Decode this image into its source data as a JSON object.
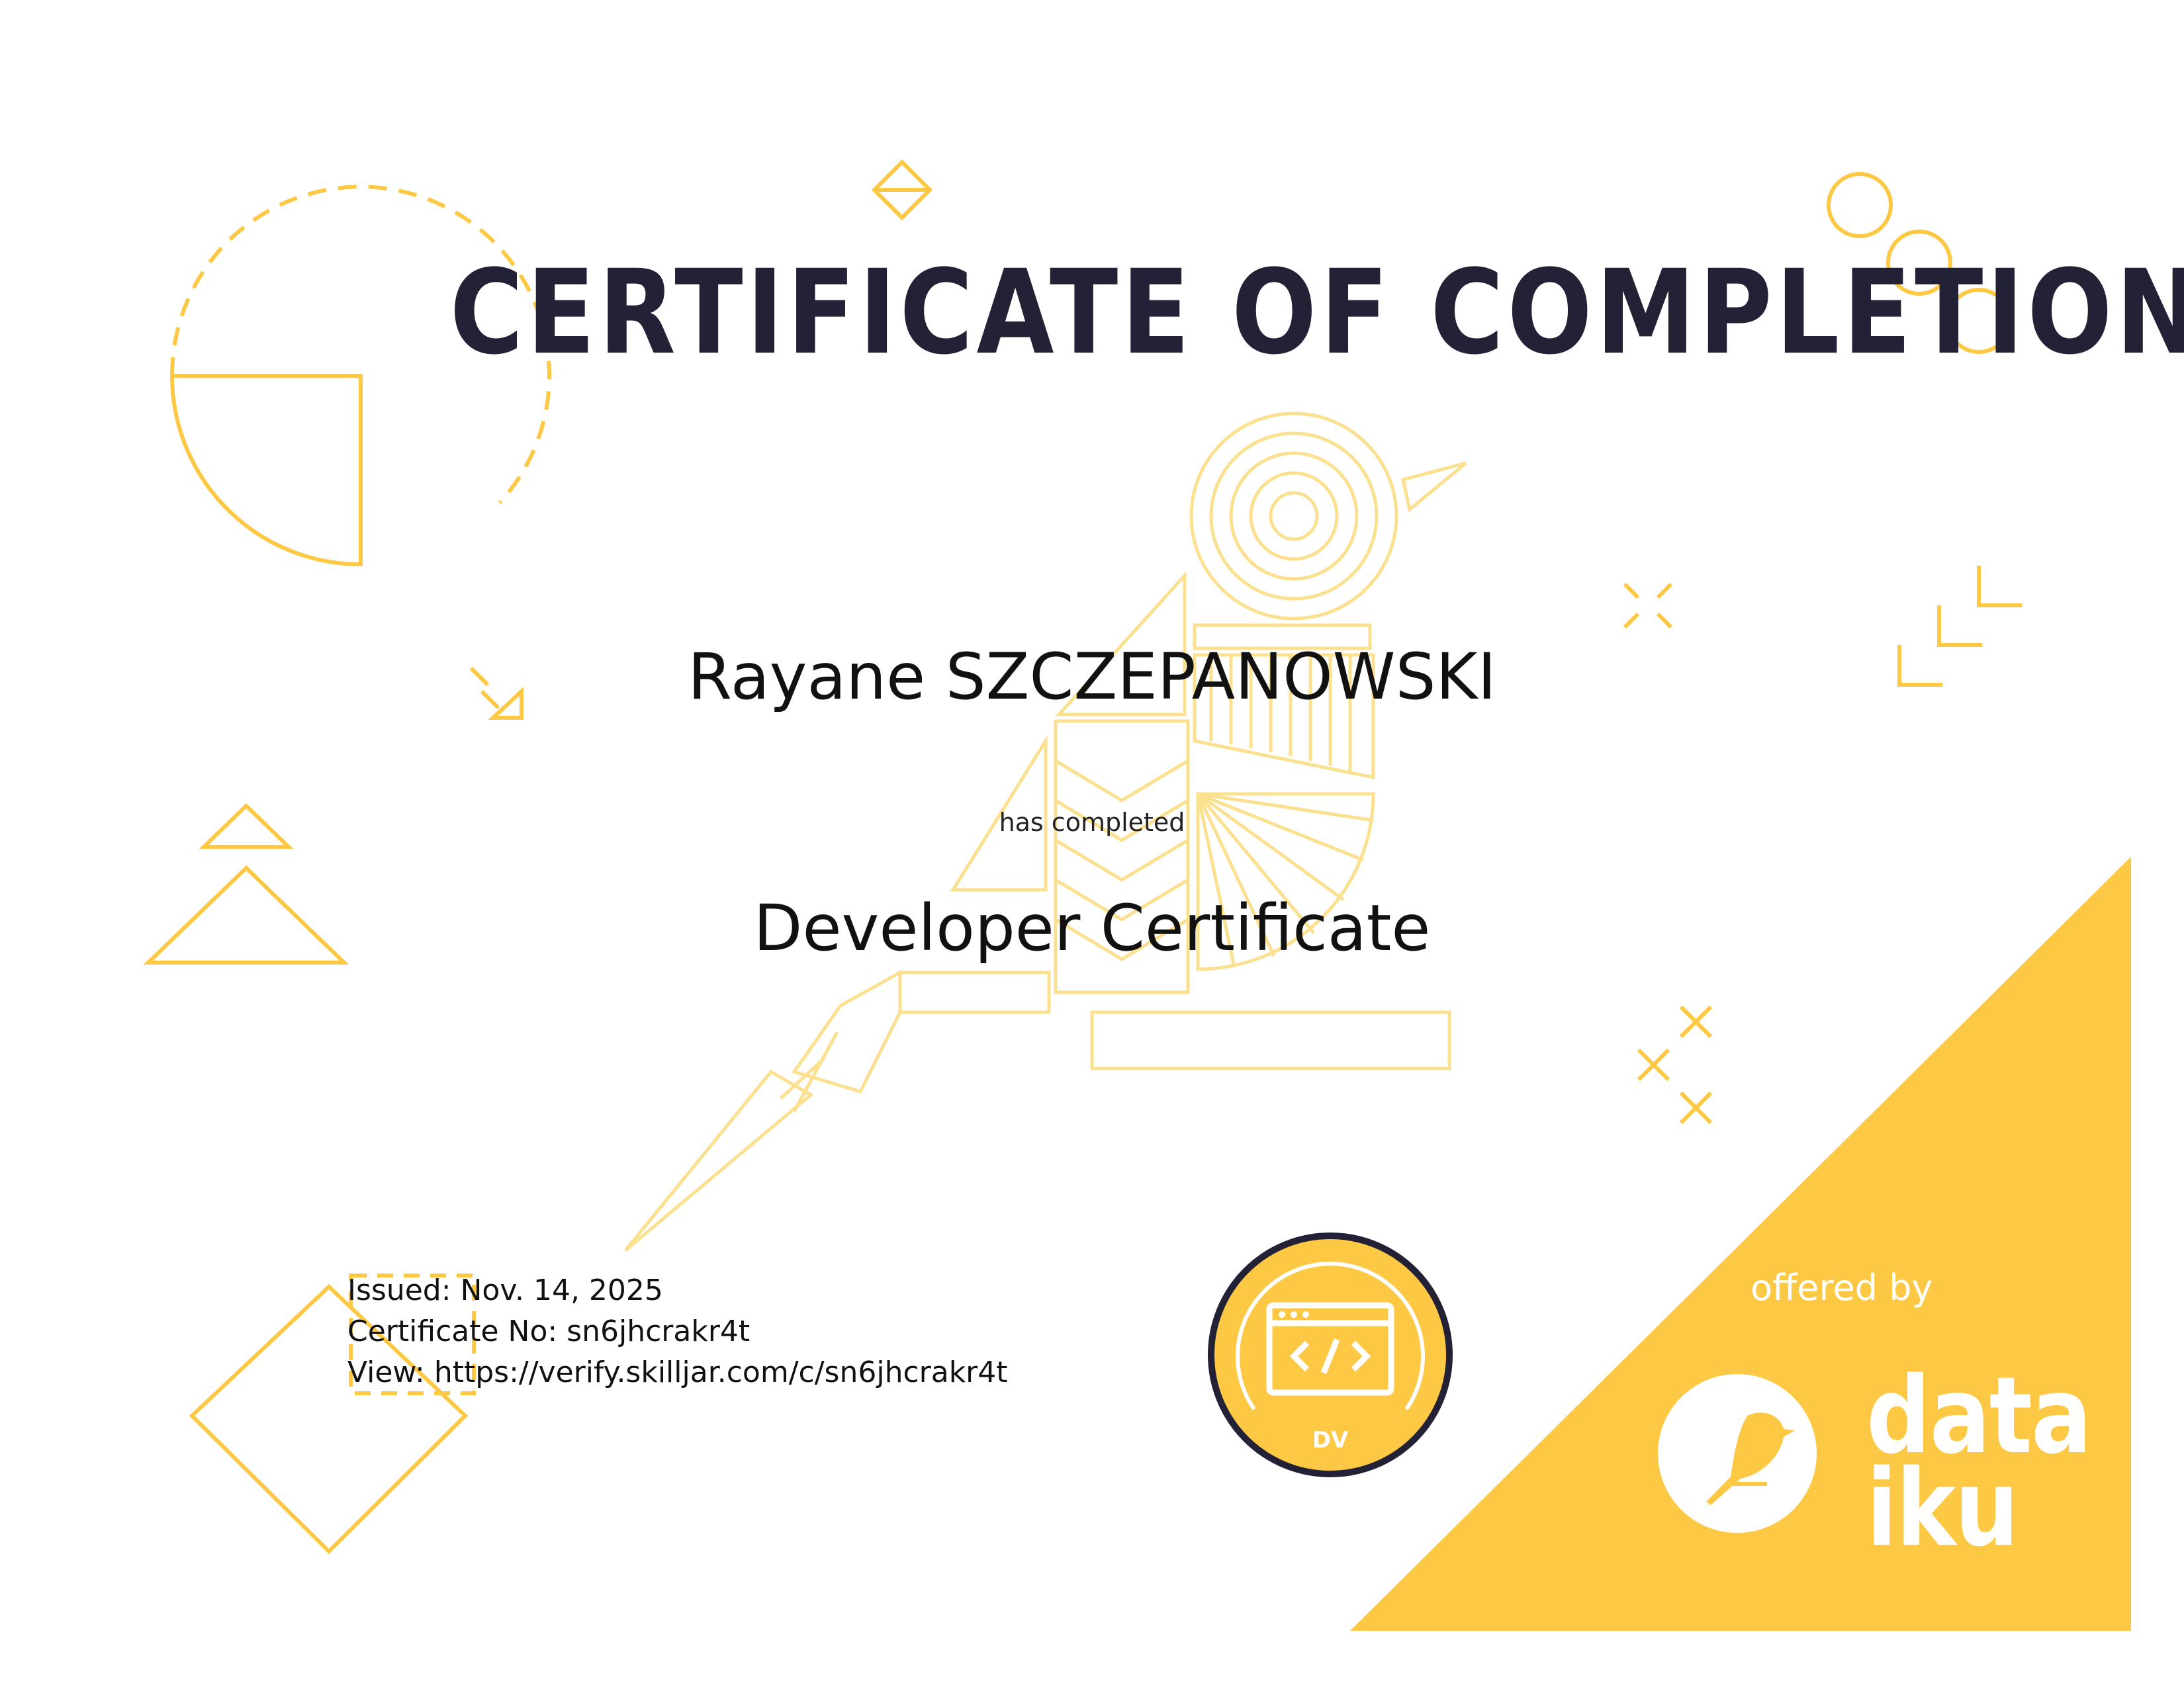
{
  "certificate": {
    "title": "CERTIFICATE OF COMPLETION",
    "recipient_name": "Rayane SZCZEPANOWSKI",
    "completed_text": "has completed",
    "course_name": "Developer Certificate",
    "issued": "Issued: Nov. 14, 2025",
    "certificate_no": "Certificate No: sn6jhcrakr4t",
    "view_url": "View: https://verify.skilljar.com/c/sn6jhcrakr4t"
  },
  "badge": {
    "label": "DV",
    "icon": "code-window-icon"
  },
  "provider": {
    "offered_by": "offered by",
    "logo_line1": "data",
    "logo_line2": "iku",
    "logo_icon": "bird-icon"
  },
  "colors": {
    "accent_yellow": "#FDC944",
    "title_navy": "#222136",
    "badge_border": "#222136",
    "background": "#FFFFFF"
  }
}
